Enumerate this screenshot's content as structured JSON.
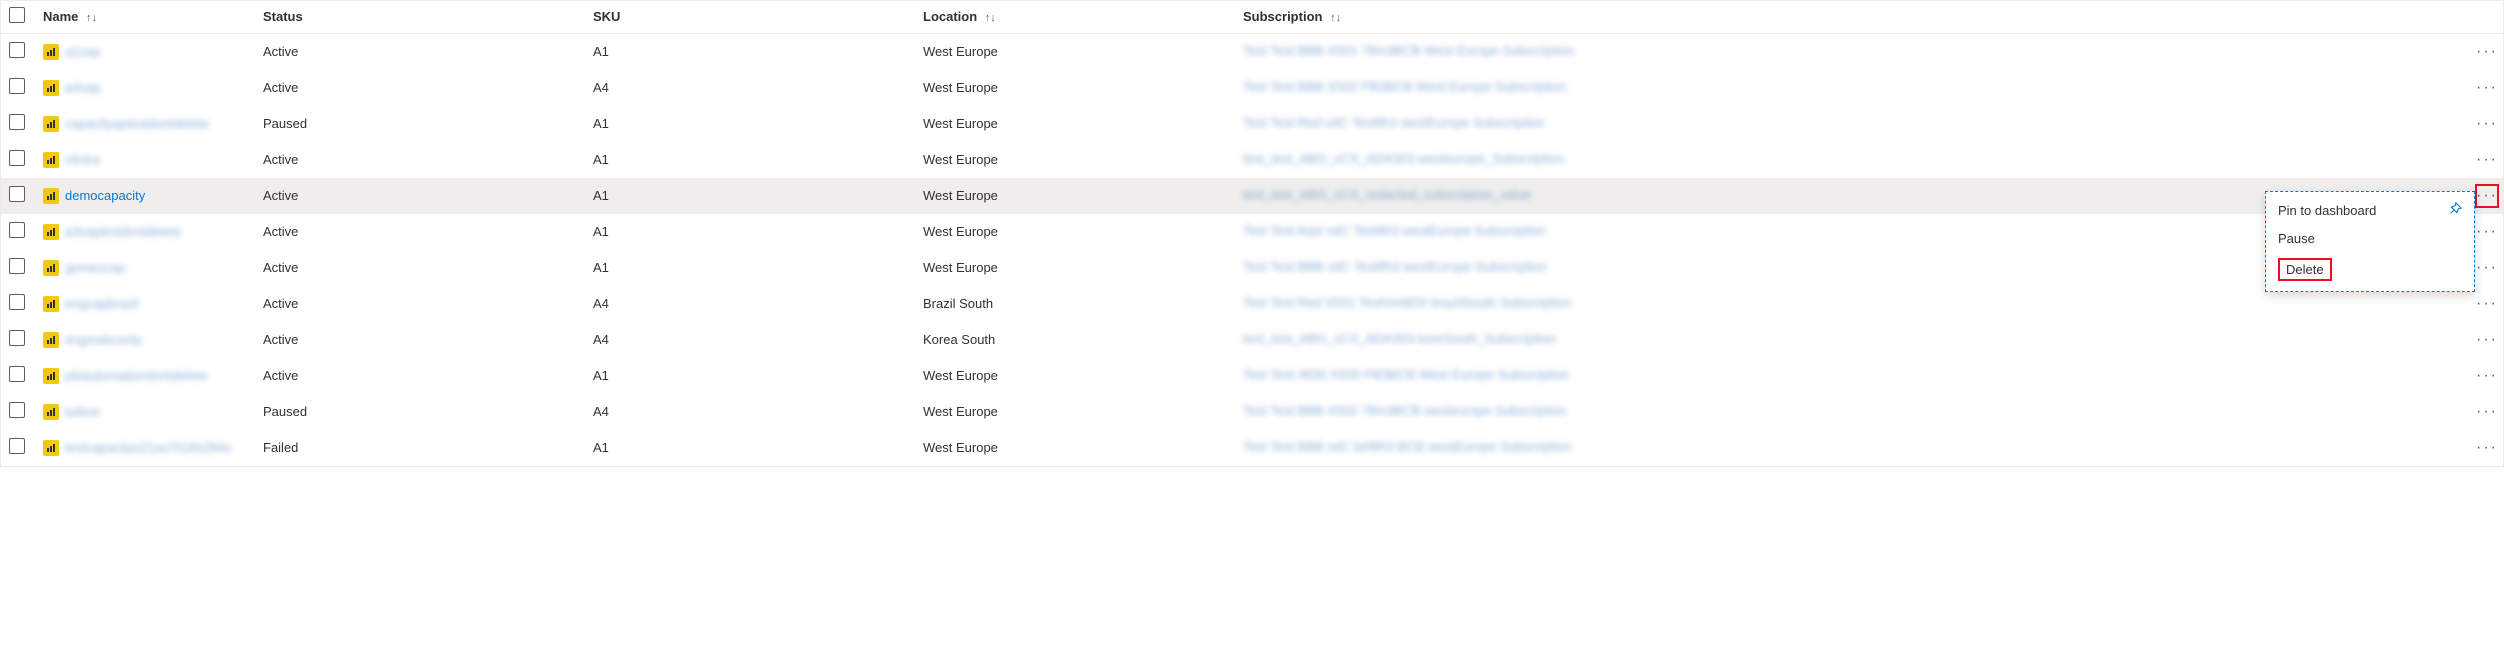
{
  "columns": {
    "name": "Name",
    "status": "Status",
    "sku": "SKU",
    "location": "Location",
    "subscription": "Subscription"
  },
  "sort_glyph": "↑↓",
  "rows": [
    {
      "name": "a1sap",
      "blurred": true,
      "status": "Active",
      "sku": "A1",
      "location": "West Europe",
      "subscription": "Test Test BBB X501 78m3BCB West Europe Subscription",
      "hovered": false,
      "menu_open": false
    },
    {
      "name": "a4sap",
      "blurred": true,
      "status": "Active",
      "sku": "A4",
      "location": "West Europe",
      "subscription": "Test Test BBB X502 PB3BCB West Europe Subscription",
      "hovered": false,
      "menu_open": false
    },
    {
      "name": "capacityaptestdontdelete",
      "blurred": true,
      "status": "Paused",
      "sku": "A1",
      "location": "West Europe",
      "subscription": "Test Test Red vdC Test8h3 westEurope Subscription",
      "hovered": false,
      "menu_open": false
    },
    {
      "name": "clintra",
      "blurred": true,
      "status": "Active",
      "sku": "A1",
      "location": "West Europe",
      "subscription": "test_test_ABG_xCX_ADA303 westeurope_Subscription",
      "hovered": false,
      "menu_open": false
    },
    {
      "name": "democapacity",
      "blurred": false,
      "status": "Active",
      "sku": "A1",
      "location": "West Europe",
      "subscription": "test_test_ABG_xCX_redacted_subscription_value",
      "hovered": true,
      "menu_open": true
    },
    {
      "name": "a3saplestdontdelete",
      "blurred": true,
      "status": "Active",
      "sku": "A1",
      "location": "West Europe",
      "subscription": "Test Test Aqst vdC Test8h3 westEurope Subscription",
      "hovered": false,
      "menu_open": false
    },
    {
      "name": "gomezcap",
      "blurred": true,
      "status": "Active",
      "sku": "A1",
      "location": "West Europe",
      "subscription": "Test Test BBB vdC Test8h3 westEurope Subscription",
      "hovered": false,
      "menu_open": false
    },
    {
      "name": "engcapbrazil",
      "blurred": true,
      "status": "Active",
      "sku": "A4",
      "location": "Brazil South",
      "subscription": "Test Test Red X501 TestVm8DX brazilSouth Subscription",
      "hovered": false,
      "menu_open": false
    },
    {
      "name": "engmakconly",
      "blurred": true,
      "status": "Active",
      "sku": "A4",
      "location": "Korea South",
      "subscription": "test_test_ABG_xCX_ADA303 koreSouth_Subscription",
      "hovered": false,
      "menu_open": false
    },
    {
      "name": "pbiautomationdontdelete",
      "blurred": true,
      "status": "Active",
      "sku": "A1",
      "location": "West Europe",
      "subscription": "Test Test 4830 X505 PB3BCB West Europe Subscription",
      "hovered": false,
      "menu_open": false
    },
    {
      "name": "tuitest",
      "blurred": true,
      "status": "Paused",
      "sku": "A4",
      "location": "West Europe",
      "subscription": "Test Test BBB X502 78m3BCB westeurope Subscription",
      "hovered": false,
      "menu_open": false
    },
    {
      "name": "testcapacitys21ss7018s284s",
      "blurred": true,
      "status": "Failed",
      "sku": "A1",
      "location": "West Europe",
      "subscription": "Test Test BBB vdC bef8h3 BCB westEurope Subscription",
      "hovered": false,
      "menu_open": false
    }
  ],
  "context_menu": {
    "pin": "Pin to dashboard",
    "pause": "Pause",
    "delete": "Delete"
  }
}
